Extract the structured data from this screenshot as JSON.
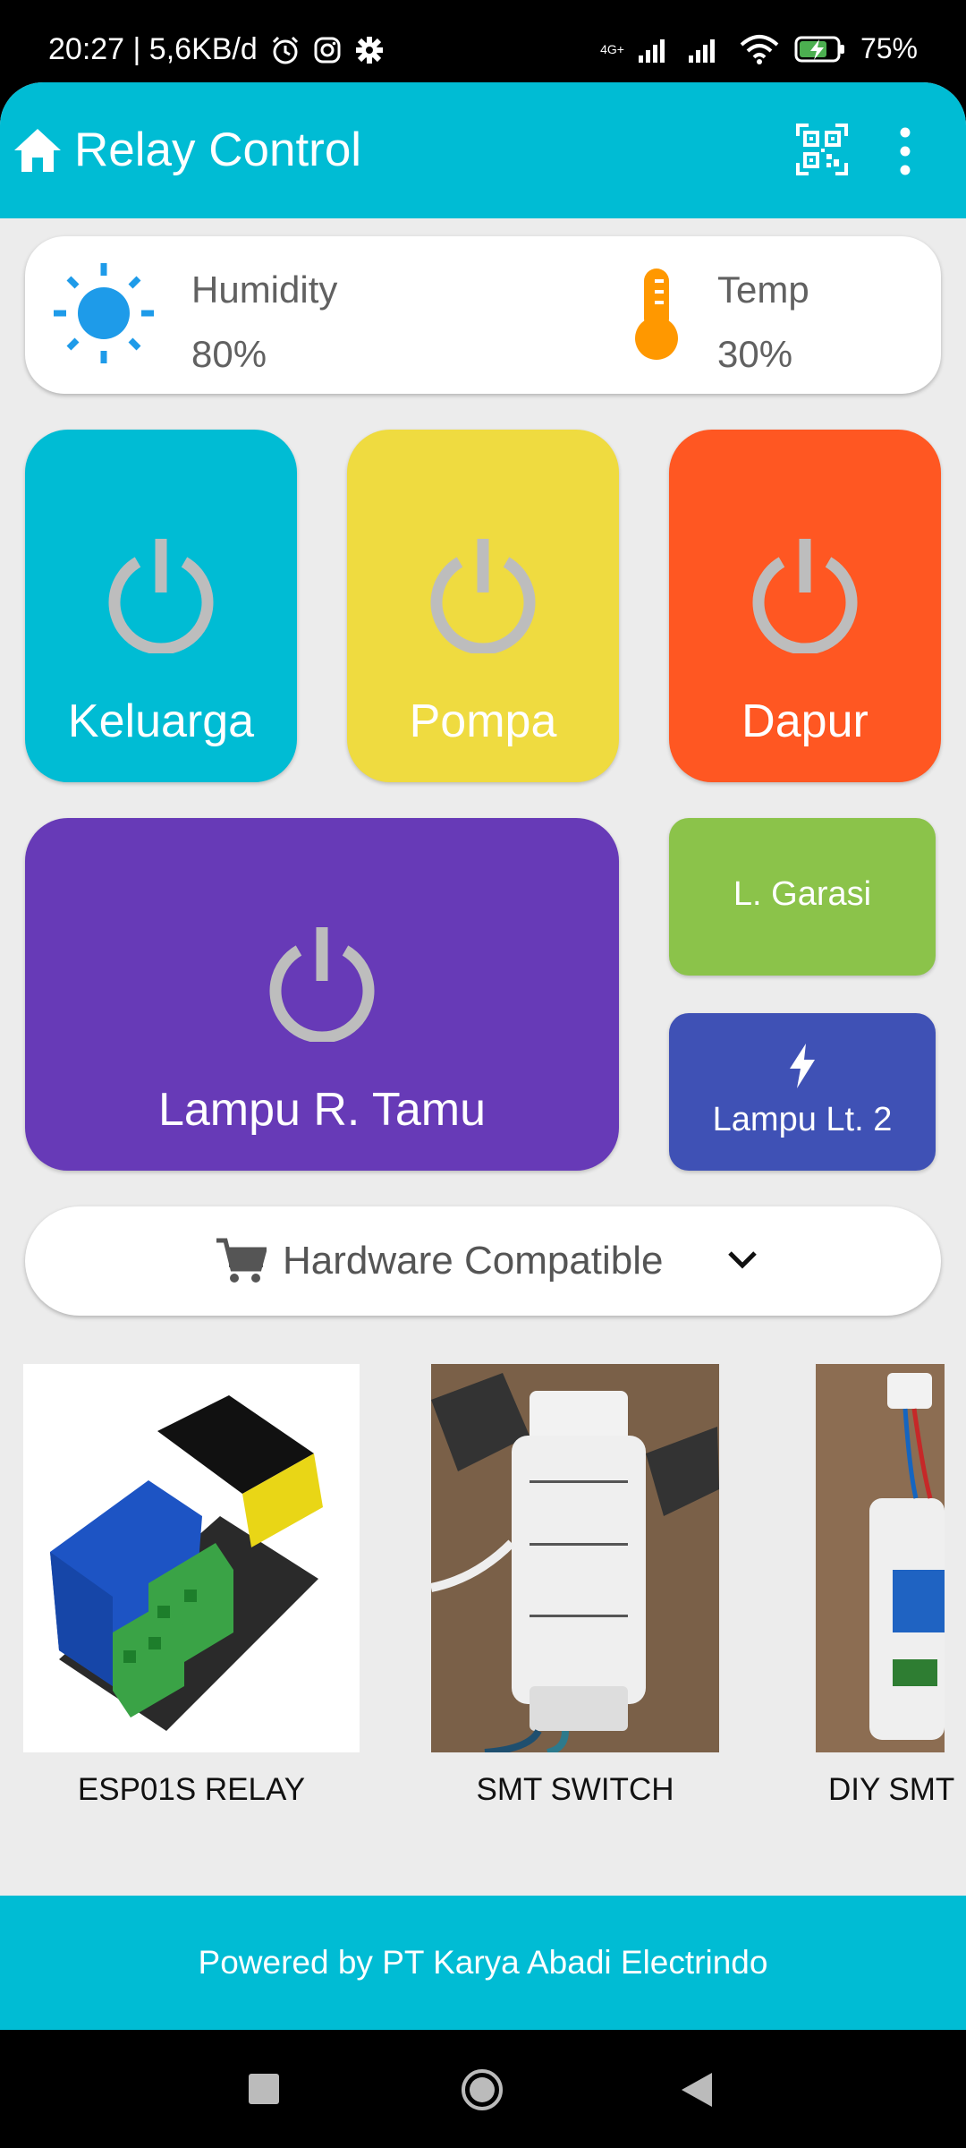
{
  "status_bar": {
    "time_speed": "20:27 | 5,6KB/d",
    "network": "4G+",
    "battery": "75%",
    "icons": [
      "alarm-icon",
      "instagram-icon",
      "settings-icon",
      "signal-icon",
      "wifi-icon",
      "battery-charging-icon"
    ]
  },
  "app_bar": {
    "title": "Relay Control",
    "icons": [
      "home-icon",
      "qr-scan-icon",
      "more-vert-icon"
    ]
  },
  "weather": {
    "humidity_label": "Humidity",
    "humidity_value": "80%",
    "temp_label": "Temp",
    "temp_value": "30%",
    "icons": [
      "sun-icon",
      "thermometer-icon"
    ]
  },
  "relays": {
    "keluarga": "Keluarga",
    "pompa": "Pompa",
    "dapur": "Dapur",
    "lampu_tamu": "Lampu R. Tamu",
    "garasi": "L. Garasi",
    "lampu_lt2": "Lampu Lt. 2"
  },
  "colors": {
    "primary": "#00bcd4",
    "keluarga": "#00bcd4",
    "pompa": "#efdb40",
    "dapur": "#ff5722",
    "lampu_tamu": "#673ab7",
    "garasi": "#8bc34a",
    "lampu_lt2": "#3f51b5",
    "power_icon": "#bdbdbd"
  },
  "hardware": {
    "label": "Hardware Compatible",
    "icons": [
      "cart-icon",
      "chevron-down-icon"
    ]
  },
  "products": [
    {
      "name": "ESP01S RELAY"
    },
    {
      "name": "SMT SWITCH"
    },
    {
      "name": "DIY SMT"
    }
  ],
  "footer": {
    "text": "Powered by PT Karya Abadi Electrindo"
  },
  "nav_bar": {
    "icons": [
      "recents-square-icon",
      "home-circle-icon",
      "back-triangle-icon"
    ]
  }
}
